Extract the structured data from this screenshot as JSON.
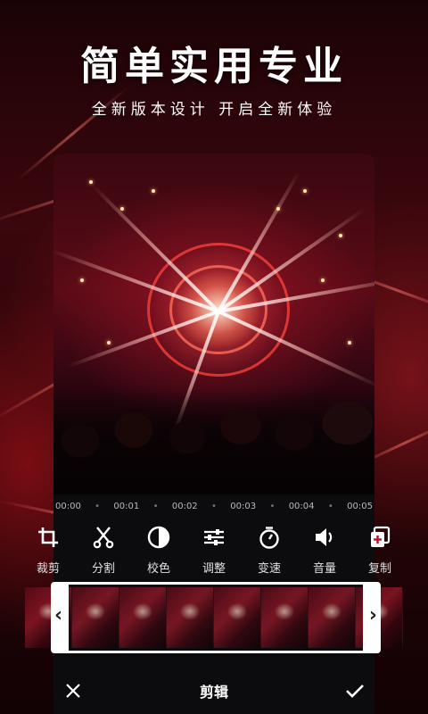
{
  "promo": {
    "headline": "简单实用专业",
    "subline": "全新版本设计  开启全新体验"
  },
  "timeline": {
    "ticks": [
      "00:00",
      "00:01",
      "00:02",
      "00:03",
      "00:04",
      "00:05"
    ]
  },
  "tools": [
    {
      "label": "裁剪",
      "icon": "crop-icon"
    },
    {
      "label": "分割",
      "icon": "scissors-icon"
    },
    {
      "label": "校色",
      "icon": "color-adjust-icon"
    },
    {
      "label": "调整",
      "icon": "sliders-icon"
    },
    {
      "label": "变速",
      "icon": "stopwatch-icon"
    },
    {
      "label": "音量",
      "icon": "volume-icon"
    },
    {
      "label": "复制",
      "icon": "copy-icon"
    }
  ],
  "bottom_bar": {
    "title": "剪辑",
    "cancel_icon": "close-icon",
    "confirm_icon": "check-icon"
  },
  "colors": {
    "accent_red": "#b8142a",
    "panel_bg": "#0c0c0e",
    "text": "#ffffff"
  }
}
